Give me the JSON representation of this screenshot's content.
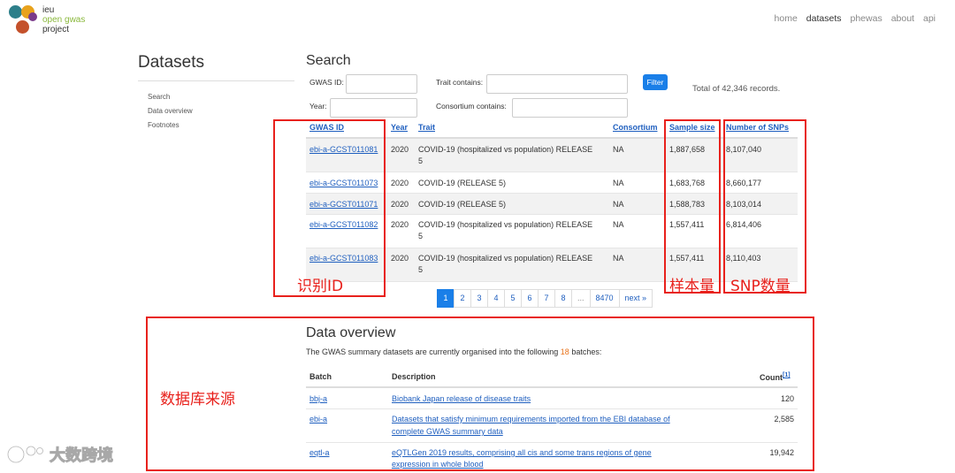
{
  "brand": {
    "line1": "ieu",
    "line2": "open gwas",
    "line3": "project",
    "dot_colors": [
      "#2d7f8a",
      "#e8a21c",
      "#7a3a8a",
      "#c4512b"
    ]
  },
  "topnav": [
    "home",
    "datasets",
    "phewas",
    "about",
    "api"
  ],
  "page_title": "Datasets",
  "sidenav": [
    "Search",
    "Data overview",
    "Footnotes"
  ],
  "search": {
    "title": "Search",
    "gwas_id_label": "GWAS ID:",
    "year_label": "Year:",
    "trait_label": "Trait contains:",
    "consortium_label": "Consortium contains:",
    "filter_label": "Filter",
    "total_text": "Total of 42,346 records."
  },
  "table": {
    "headers": [
      "GWAS ID",
      "Year",
      "Trait",
      "Consortium",
      "Sample size",
      "Number of SNPs"
    ],
    "rows": [
      {
        "id": "ebi-a-GCST011081",
        "year": "2020",
        "trait1": "COVID-19 (hospitalized vs population) RELEASE",
        "trait2": "5",
        "consortium": "NA",
        "sample": "1,887,658",
        "snps": "8,107,040"
      },
      {
        "id": "ebi-a-GCST011073",
        "year": "2020",
        "trait1": "COVID-19 (RELEASE 5)",
        "trait2": "",
        "consortium": "NA",
        "sample": "1,683,768",
        "snps": "8,660,177"
      },
      {
        "id": "ebi-a-GCST011071",
        "year": "2020",
        "trait1": "COVID-19 (RELEASE 5)",
        "trait2": "",
        "consortium": "NA",
        "sample": "1,588,783",
        "snps": "8,103,014"
      },
      {
        "id": "ebi-a-GCST011082",
        "year": "2020",
        "trait1": "COVID-19 (hospitalized vs population) RELEASE",
        "trait2": "5",
        "consortium": "NA",
        "sample": "1,557,411",
        "snps": "6,814,406"
      },
      {
        "id": "ebi-a-GCST011083",
        "year": "2020",
        "trait1": "COVID-19 (hospitalized vs population) RELEASE",
        "trait2": "5",
        "consortium": "NA",
        "sample": "1,557,411",
        "snps": "8,110,403"
      }
    ]
  },
  "pagination": [
    "1",
    "2",
    "3",
    "4",
    "5",
    "6",
    "7",
    "8",
    "...",
    "8470",
    "next »"
  ],
  "overview": {
    "title": "Data overview",
    "text_before": "The GWAS summary datasets are currently organised into the following ",
    "batch_count": "18",
    "text_after": " batches:",
    "headers": {
      "batch": "Batch",
      "description": "Description",
      "count": "Count",
      "footnote": "[1]"
    },
    "rows": [
      {
        "batch": "bbj-a",
        "desc1": "Biobank Japan release of disease traits",
        "desc2": "",
        "count": "120"
      },
      {
        "batch": "ebi-a",
        "desc1": "Datasets that satisfy minimum requirements imported from the EBI database of",
        "desc2": "complete GWAS summary data",
        "count": "2,585"
      },
      {
        "batch": "eqtl-a",
        "desc1": "eQTLGen 2019 results, comprising all cis and some trans regions of gene",
        "desc2": "expression in whole blood",
        "count": "19,942"
      }
    ]
  },
  "annotations": {
    "id_label": "识别ID",
    "sample_label": "样本量",
    "snp_label": "SNP数量",
    "source_label": "数据库来源",
    "color": "#e8211c"
  },
  "watermark": "大数跨境"
}
